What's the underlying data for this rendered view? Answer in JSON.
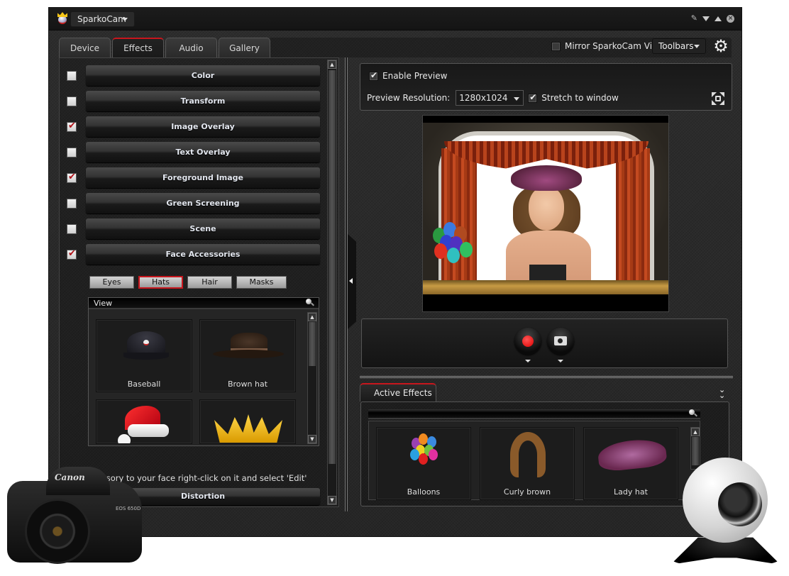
{
  "window": {
    "app_menu_label": "SparkoCam",
    "controls": [
      "pin-icon",
      "minimize-icon",
      "maximize-icon",
      "close-icon"
    ]
  },
  "tabs": [
    {
      "label": "Device",
      "active": false
    },
    {
      "label": "Effects",
      "active": true
    },
    {
      "label": "Audio",
      "active": false
    },
    {
      "label": "Gallery",
      "active": false
    }
  ],
  "toolbar": {
    "mirror_label": "Mirror SparkoCam Video",
    "mirror_checked": false,
    "toolbars_label": "Toolbars",
    "settings_icon": "gear-icon"
  },
  "effects": [
    {
      "label": "Color",
      "checked": false
    },
    {
      "label": "Transform",
      "checked": false
    },
    {
      "label": "Image Overlay",
      "checked": true
    },
    {
      "label": "Text Overlay",
      "checked": false
    },
    {
      "label": "Foreground Image",
      "checked": true
    },
    {
      "label": "Green Screening",
      "checked": false
    },
    {
      "label": "Scene",
      "checked": false
    },
    {
      "label": "Face Accessories",
      "checked": true
    }
  ],
  "face_accessories": {
    "categories": [
      {
        "label": "Eyes",
        "active": false
      },
      {
        "label": "Hats",
        "active": true
      },
      {
        "label": "Hair",
        "active": false
      },
      {
        "label": "Masks",
        "active": false
      }
    ],
    "view_label": "View",
    "items": [
      {
        "label": "Baseball"
      },
      {
        "label": "Brown hat"
      },
      {
        "label": ""
      },
      {
        "label": ""
      }
    ],
    "hint": "ccessory to your face right-click on it and select 'Edit'"
  },
  "distortion_label": "Distortion",
  "preview": {
    "enable_label": "Enable Preview",
    "enable_checked": true,
    "resolution_label": "Preview Resolution:",
    "resolution_value": "1280x1024",
    "stretch_label": "Stretch to window",
    "stretch_checked": true
  },
  "capture": {
    "record_icon": "record-icon",
    "snapshot_icon": "camera-icon"
  },
  "active_effects": {
    "tab_label": "Active Effects",
    "items": [
      {
        "label": "Balloons"
      },
      {
        "label": "Curly brown"
      },
      {
        "label": "Lady hat"
      }
    ]
  },
  "decor": {
    "camera_brand": "Canon",
    "camera_model": "EOS 650D"
  },
  "colors": {
    "accent_red": "#c8161d",
    "record_red": "#e00000"
  }
}
